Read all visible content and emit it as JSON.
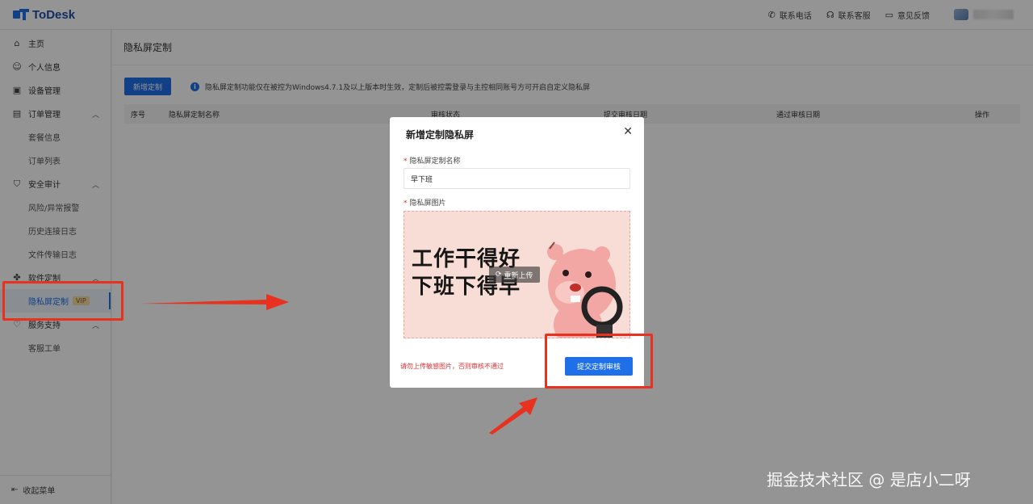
{
  "app": {
    "name": "ToDesk"
  },
  "topbar": {
    "actions": [
      {
        "label": "联系电话",
        "icon": "phone-icon"
      },
      {
        "label": "联系客服",
        "icon": "headset-icon"
      },
      {
        "label": "意见反馈",
        "icon": "feedback-icon"
      }
    ]
  },
  "sidebar": {
    "home": "主页",
    "profile": "个人信息",
    "devices": "设备管理",
    "orders": "订单管理",
    "orders_sub": [
      "套餐信息",
      "订单列表"
    ],
    "audit": "安全审计",
    "audit_sub": [
      "风险/异常报警",
      "历史连接日志",
      "文件传输日志"
    ],
    "customize": "软件定制",
    "customize_sub": "隐私屏定制",
    "vip": "VIP",
    "support": "服务支持",
    "support_sub": "客服工单",
    "collapse": "收起菜单"
  },
  "page": {
    "title": "隐私屏定制",
    "new_button": "新增定制",
    "tip": "隐私屏定制功能仅在被控为Windows4.7.1及以上版本时生效，定制后被控需登录与主控相同账号方可开启自定义隐私屏",
    "table_headers": [
      "序号",
      "隐私屏定制名称",
      "审核状态",
      "提交审核日期",
      "通过审核日期",
      "操作"
    ]
  },
  "modal": {
    "title": "新增定制隐私屏",
    "name_label": "隐私屏定制名称",
    "name_value": "早下班",
    "image_label": "隐私屏图片",
    "preview_lines": [
      "工作干得好",
      "下班下得早"
    ],
    "reupload": "重新上传",
    "warning": "请勿上传敏感图片，否则审核不通过",
    "submit": "提交定制审核"
  },
  "watermark": "掘金技术社区 @ 是店小二呀",
  "colors": {
    "accent": "#1e6fe8",
    "highlight": "#e8321f"
  }
}
